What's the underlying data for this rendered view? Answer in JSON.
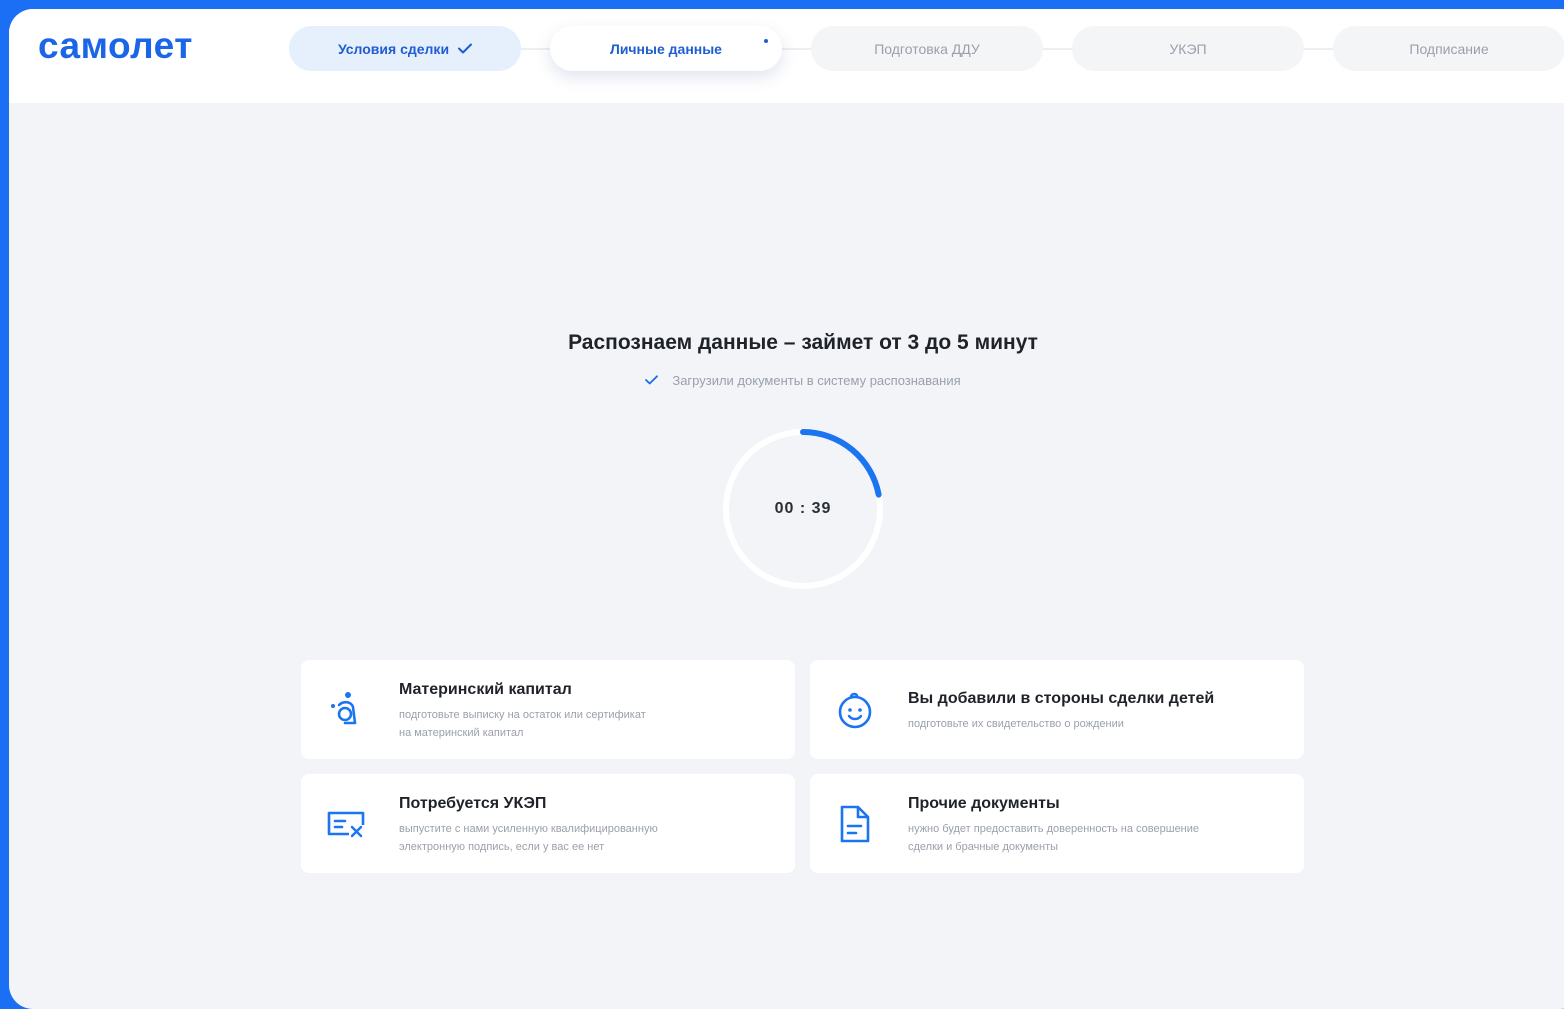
{
  "brand": {
    "logo": "самолет",
    "accent": "#1b66e8"
  },
  "stepper": {
    "steps": [
      {
        "label": "Условия сделки",
        "state": "done"
      },
      {
        "label": "Личные данные",
        "state": "active"
      },
      {
        "label": "Подготовка ДДУ",
        "state": "pending"
      },
      {
        "label": "УКЭП",
        "state": "pending"
      },
      {
        "label": "Подписание",
        "state": "pending"
      }
    ]
  },
  "status": {
    "heading": "Распознаем данные – займет от 3 до 5 минут",
    "done_item": "Загрузили документы в систему распознавания"
  },
  "timer": {
    "value": "00 : 39",
    "progress": 0.22
  },
  "cards": [
    {
      "icon": "mother-child-icon",
      "title": "Материнский капитал",
      "desc_line1": "подготовьте выписку на остаток или сертификат",
      "desc_line2": "на материнский капитал"
    },
    {
      "icon": "baby-face-icon",
      "title": "Вы добавили в стороны сделки детей",
      "desc_line1": "подготовьте их свидетельство о рождении",
      "desc_line2": ""
    },
    {
      "icon": "signature-card-icon",
      "title": "Потребуется УКЭП",
      "desc_line1": "выпустите с нами усиленную квалифицированную",
      "desc_line2": "электронную подпись, если у вас ее нет"
    },
    {
      "icon": "document-icon",
      "title": "Прочие документы",
      "desc_line1": "нужно будет предоставить доверенность на совершение",
      "desc_line2": "сделки и брачные документы"
    }
  ]
}
